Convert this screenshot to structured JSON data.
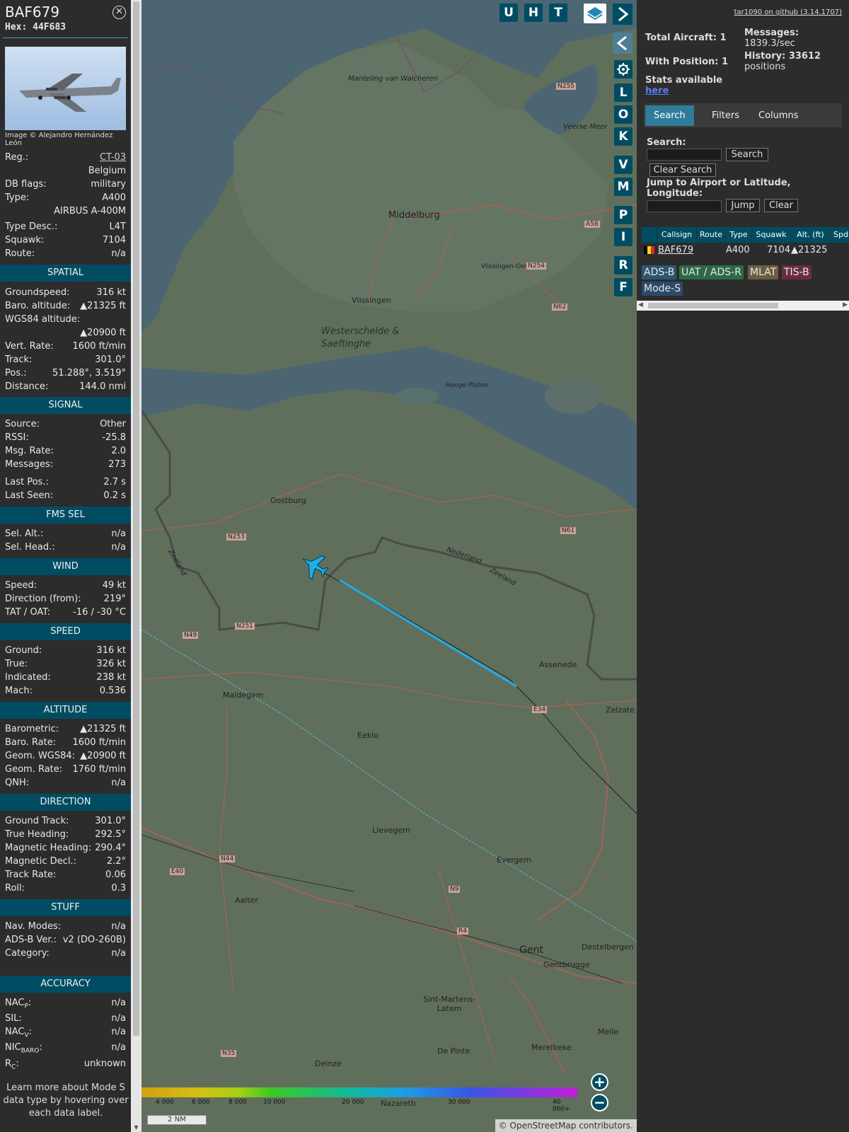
{
  "aircraft": {
    "callsign": "BAF679",
    "hex_label": "Hex:",
    "hex": "44F683",
    "image_credit": "Image © Alejandro Hernández León"
  },
  "info": {
    "reg": {
      "k": "Reg.:",
      "v": "CT-03"
    },
    "country": "Belgium",
    "dbflags": {
      "k": "DB flags:",
      "v": "military"
    },
    "type": {
      "k": "Type:",
      "v": "A400"
    },
    "type_full": "AIRBUS A-400M",
    "typedesc": {
      "k": "Type Desc.:",
      "v": "L4T"
    },
    "squawk": {
      "k": "Squawk:",
      "v": "7104"
    },
    "route": {
      "k": "Route:",
      "v": "n/a"
    }
  },
  "spatial": {
    "title": "SPATIAL",
    "gs": {
      "k": "Groundspeed:",
      "v": "316 kt"
    },
    "baro": {
      "k": "Baro. altitude:",
      "v": "▲21325 ft"
    },
    "wgs": {
      "k": "WGS84 altitude:",
      "v": "▲20900 ft"
    },
    "vrate": {
      "k": "Vert. Rate:",
      "v": "1600 ft/min"
    },
    "track": {
      "k": "Track:",
      "v": "301.0°"
    },
    "pos": {
      "k": "Pos.:",
      "v": "51.288°, 3.519°"
    },
    "dist": {
      "k": "Distance:",
      "v": "144.0 nmi"
    }
  },
  "signal": {
    "title": "SIGNAL",
    "source": {
      "k": "Source:",
      "v": "Other"
    },
    "rssi": {
      "k": "RSSI:",
      "v": "-25.8"
    },
    "msgrate": {
      "k": "Msg. Rate:",
      "v": "2.0"
    },
    "messages": {
      "k": "Messages:",
      "v": "273"
    },
    "lastpos": {
      "k": "Last Pos.:",
      "v": "2.7 s"
    },
    "lastseen": {
      "k": "Last Seen:",
      "v": "0.2 s"
    }
  },
  "fms": {
    "title": "FMS SEL",
    "alt": {
      "k": "Sel. Alt.:",
      "v": "n/a"
    },
    "head": {
      "k": "Sel. Head.:",
      "v": "n/a"
    }
  },
  "wind": {
    "title": "WIND",
    "speed": {
      "k": "Speed:",
      "v": "49 kt"
    },
    "dir": {
      "k": "Direction (from):",
      "v": "219°"
    },
    "tat": {
      "k": "TAT / OAT:",
      "v": "-16 / -30 °C"
    }
  },
  "speed": {
    "title": "SPEED",
    "ground": {
      "k": "Ground:",
      "v": "316 kt"
    },
    "true": {
      "k": "True:",
      "v": "326 kt"
    },
    "ind": {
      "k": "Indicated:",
      "v": "238 kt"
    },
    "mach": {
      "k": "Mach:",
      "v": "0.536"
    }
  },
  "altitude": {
    "title": "ALTITUDE",
    "baro": {
      "k": "Barometric:",
      "v": "▲21325 ft"
    },
    "brate": {
      "k": "Baro. Rate:",
      "v": "1600 ft/min"
    },
    "geom": {
      "k": "Geom. WGS84:",
      "v": "▲20900 ft"
    },
    "grate": {
      "k": "Geom. Rate:",
      "v": "1760 ft/min"
    },
    "qnh": {
      "k": "QNH:",
      "v": "n/a"
    }
  },
  "direction": {
    "title": "DIRECTION",
    "gtrack": {
      "k": "Ground Track:",
      "v": "301.0°"
    },
    "thead": {
      "k": "True Heading:",
      "v": "292.5°"
    },
    "mhead": {
      "k": "Magnetic Heading:",
      "v": "290.4°"
    },
    "mdecl": {
      "k": "Magnetic Decl.:",
      "v": "2.2°"
    },
    "trate": {
      "k": "Track Rate:",
      "v": "0.06"
    },
    "roll": {
      "k": "Roll:",
      "v": "0.3"
    }
  },
  "stuff": {
    "title": "STUFF",
    "nav": {
      "k": "Nav. Modes:",
      "v": "n/a"
    },
    "adsb": {
      "k": "ADS-B Ver.:",
      "v": "v2 (DO-260B)"
    },
    "cat": {
      "k": "Category:",
      "v": "n/a"
    }
  },
  "accuracy": {
    "title": "ACCURACY",
    "nacp": {
      "k": "NAC",
      "sub": "P",
      "v": "n/a"
    },
    "sil": {
      "k": "SIL:",
      "v": "n/a"
    },
    "nacv": {
      "k": "NAC",
      "sub": "V",
      "v": "n/a"
    },
    "nicbaro": {
      "k": "NIC",
      "sub": "BARO",
      "v": "n/a"
    },
    "rc": {
      "k": "R",
      "sub": "C",
      "v": "unknown"
    }
  },
  "note": "Learn more about Mode S data type by hovering over each data label.",
  "map": {
    "buttons_top": [
      "U",
      "H",
      "T"
    ],
    "buttons_side": [
      "L",
      "O",
      "K",
      "V",
      "M",
      "P",
      "I",
      "R",
      "F"
    ],
    "labels": [
      "Manteling van Walcheren",
      "Veerse Meer",
      "Middelburg",
      "Vlissingen",
      "Vlissingen-Oost",
      "Westerschelde & Saeftinghe",
      "Hooge Platen",
      "Oostburg",
      "Nederland",
      "Zeeland",
      "Zeeland",
      "Assenede",
      "Maldegem",
      "Eeklo",
      "Zelzate",
      "Lievegem",
      "Evergem",
      "Aalter",
      "Gent",
      "Gentbrugge",
      "Destelbergen",
      "Sint-Martens-Latem",
      "De Pinte",
      "Merelbeke",
      "Melle",
      "Deinze",
      "Nazareth"
    ],
    "roads": [
      "N255",
      "N254",
      "N62",
      "A58",
      "N253",
      "N251",
      "N49",
      "N61",
      "E34",
      "N44",
      "E40",
      "N9",
      "R4",
      "N35"
    ],
    "colorbar_ticks": [
      "4 000",
      "6 000",
      "8 000",
      "10 000",
      "20 000",
      "30 000",
      "40 000+"
    ],
    "scale": "2 NM",
    "copyright": "© OpenStreetMap contributors."
  },
  "right": {
    "github": "tar1090 on github (3.14.1707)",
    "total": "Total Aircraft: 1",
    "withpos": "With Position: 1",
    "messages_l1": "Messages:",
    "messages_l2": "1839.3/sec",
    "history_l1": "History: 33612",
    "history_l2": "positions",
    "stats_l1": "Stats available",
    "stats_link": "here",
    "tabs": [
      "Search",
      "Filters",
      "Columns"
    ],
    "search_label": "Search:",
    "search_btn": "Search",
    "clear_search_btn": "Clear Search",
    "jump_label": "Jump to Airport or Latitude, Longitude:",
    "jump_btn": "Jump",
    "clear_btn": "Clear",
    "columns": [
      "Callsign",
      "Route",
      "Type",
      "Squawk",
      "Alt. (ft)",
      "Spd"
    ],
    "row": {
      "callsign": "BAF679",
      "type": "A400",
      "squawk": "7104",
      "alt": "▲21325"
    },
    "chips": [
      "ADS-B",
      "UAT / ADS-R",
      "MLAT",
      "TIS-B",
      "Mode-S"
    ]
  },
  "colors": {
    "panel": "#2c2c2c",
    "header": "#004d63",
    "accent": "#2e7c9a",
    "aircraft": "#1eaee8"
  }
}
